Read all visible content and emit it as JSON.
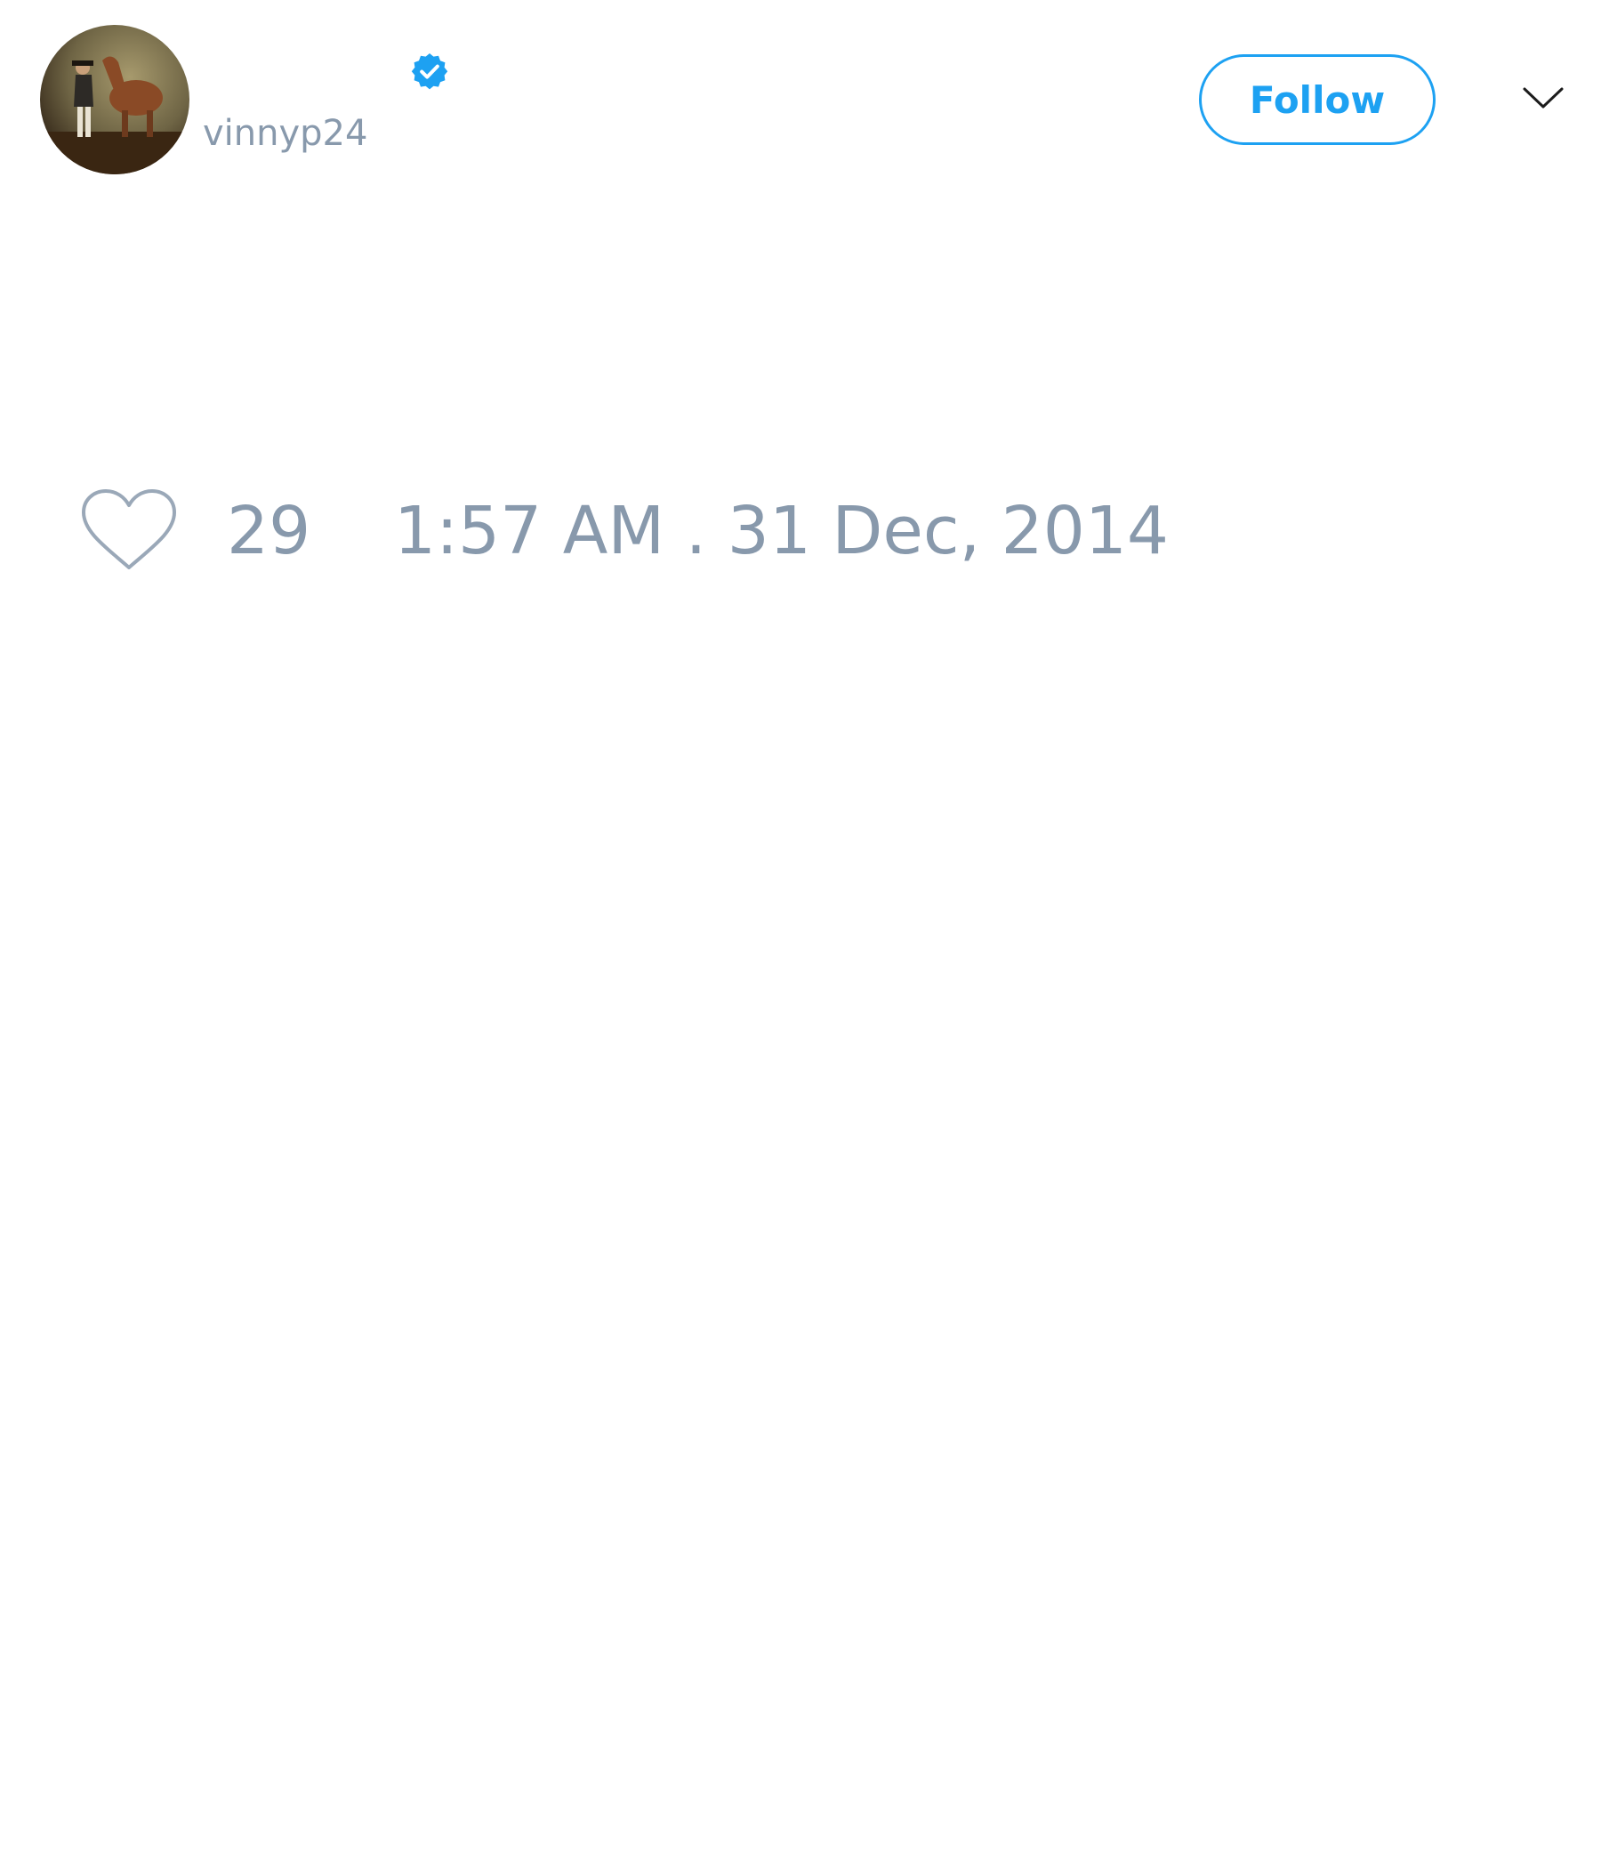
{
  "author": {
    "handle": "vinnyp24",
    "verified": true
  },
  "actions": {
    "follow_label": "Follow"
  },
  "stats": {
    "like_count": "29"
  },
  "timestamp": "1:57 AM . 31 Dec, 2014",
  "colors": {
    "accent": "#1da1f2",
    "muted_text": "#8899ac",
    "background": "#ffffff"
  },
  "icons": {
    "verified": "verified-badge-icon",
    "caret": "chevron-down-icon",
    "like": "heart-icon"
  }
}
